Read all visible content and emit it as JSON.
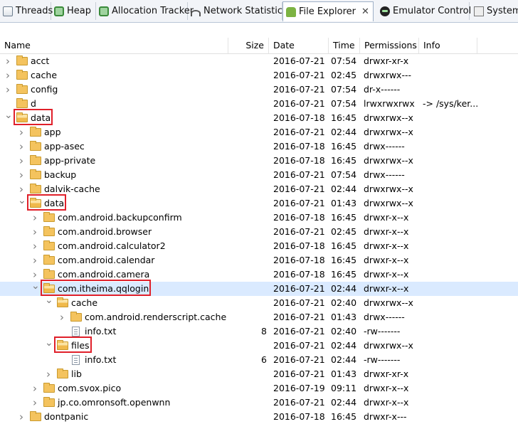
{
  "tabs": [
    {
      "label": "Threads",
      "icon": "threads-icon"
    },
    {
      "label": "Heap",
      "icon": "heap-icon"
    },
    {
      "label": "Allocation Tracker",
      "icon": "allocation-tracker-icon"
    },
    {
      "label": "Network Statistics",
      "icon": "network-icon"
    },
    {
      "label": "File Explorer",
      "icon": "android-icon",
      "active": true,
      "close": "✕"
    },
    {
      "label": "Emulator Control",
      "icon": "emulator-icon"
    },
    {
      "label": "System",
      "icon": "system-icon"
    }
  ],
  "columns": {
    "name": "Name",
    "size": "Size",
    "date": "Date",
    "time": "Time",
    "permissions": "Permissions",
    "info": "Info"
  },
  "rows": [
    {
      "name": "acct",
      "level": 0,
      "type": "folder",
      "state": "collapsed",
      "size": "",
      "date": "2016-07-21",
      "time": "07:54",
      "perm": "drwxr-xr-x",
      "info": ""
    },
    {
      "name": "cache",
      "level": 0,
      "type": "folder",
      "state": "collapsed",
      "size": "",
      "date": "2016-07-21",
      "time": "02:45",
      "perm": "drwxrwx---",
      "info": ""
    },
    {
      "name": "config",
      "level": 0,
      "type": "folder",
      "state": "collapsed",
      "size": "",
      "date": "2016-07-21",
      "time": "07:54",
      "perm": "dr-x------",
      "info": ""
    },
    {
      "name": "d",
      "level": 0,
      "type": "folder",
      "state": "none",
      "size": "",
      "date": "2016-07-21",
      "time": "07:54",
      "perm": "lrwxrwxrwx",
      "info": "-> /sys/ker..."
    },
    {
      "name": "data",
      "level": 0,
      "type": "folder",
      "state": "expanded",
      "size": "",
      "date": "2016-07-18",
      "time": "16:45",
      "perm": "drwxrwx--x",
      "info": "",
      "highlight": true
    },
    {
      "name": "app",
      "level": 1,
      "type": "folder",
      "state": "collapsed",
      "size": "",
      "date": "2016-07-21",
      "time": "02:44",
      "perm": "drwxrwx--x",
      "info": ""
    },
    {
      "name": "app-asec",
      "level": 1,
      "type": "folder",
      "state": "collapsed",
      "size": "",
      "date": "2016-07-18",
      "time": "16:45",
      "perm": "drwx------",
      "info": ""
    },
    {
      "name": "app-private",
      "level": 1,
      "type": "folder",
      "state": "collapsed",
      "size": "",
      "date": "2016-07-18",
      "time": "16:45",
      "perm": "drwxrwx--x",
      "info": ""
    },
    {
      "name": "backup",
      "level": 1,
      "type": "folder",
      "state": "collapsed",
      "size": "",
      "date": "2016-07-21",
      "time": "07:54",
      "perm": "drwx------",
      "info": ""
    },
    {
      "name": "dalvik-cache",
      "level": 1,
      "type": "folder",
      "state": "collapsed",
      "size": "",
      "date": "2016-07-21",
      "time": "02:44",
      "perm": "drwxrwx--x",
      "info": ""
    },
    {
      "name": "data",
      "level": 1,
      "type": "folder",
      "state": "expanded",
      "size": "",
      "date": "2016-07-21",
      "time": "01:43",
      "perm": "drwxrwx--x",
      "info": "",
      "highlight": true
    },
    {
      "name": "com.android.backupconfirm",
      "level": 2,
      "type": "folder",
      "state": "collapsed",
      "size": "",
      "date": "2016-07-18",
      "time": "16:45",
      "perm": "drwxr-x--x",
      "info": ""
    },
    {
      "name": "com.android.browser",
      "level": 2,
      "type": "folder",
      "state": "collapsed",
      "size": "",
      "date": "2016-07-21",
      "time": "02:45",
      "perm": "drwxr-x--x",
      "info": ""
    },
    {
      "name": "com.android.calculator2",
      "level": 2,
      "type": "folder",
      "state": "collapsed",
      "size": "",
      "date": "2016-07-18",
      "time": "16:45",
      "perm": "drwxr-x--x",
      "info": ""
    },
    {
      "name": "com.android.calendar",
      "level": 2,
      "type": "folder",
      "state": "collapsed",
      "size": "",
      "date": "2016-07-18",
      "time": "16:45",
      "perm": "drwxr-x--x",
      "info": ""
    },
    {
      "name": "com.android.camera",
      "level": 2,
      "type": "folder",
      "state": "collapsed",
      "size": "",
      "date": "2016-07-18",
      "time": "16:45",
      "perm": "drwxr-x--x",
      "info": ""
    },
    {
      "name": "com.itheima.qqlogin",
      "level": 2,
      "type": "folder",
      "state": "expanded",
      "size": "",
      "date": "2016-07-21",
      "time": "02:44",
      "perm": "drwxr-x--x",
      "info": "",
      "highlight": true,
      "selected": true
    },
    {
      "name": "cache",
      "level": 3,
      "type": "folder",
      "state": "expanded",
      "size": "",
      "date": "2016-07-21",
      "time": "02:40",
      "perm": "drwxrwx--x",
      "info": ""
    },
    {
      "name": "com.android.renderscript.cache",
      "level": 4,
      "type": "folder",
      "state": "collapsed",
      "size": "",
      "date": "2016-07-21",
      "time": "01:43",
      "perm": "drwx------",
      "info": ""
    },
    {
      "name": "info.txt",
      "level": 4,
      "type": "file",
      "state": "none",
      "size": "8",
      "date": "2016-07-21",
      "time": "02:40",
      "perm": "-rw-------",
      "info": ""
    },
    {
      "name": "files",
      "level": 3,
      "type": "folder",
      "state": "expanded",
      "size": "",
      "date": "2016-07-21",
      "time": "02:44",
      "perm": "drwxrwx--x",
      "info": "",
      "highlight": true
    },
    {
      "name": "info.txt",
      "level": 4,
      "type": "file",
      "state": "none",
      "size": "6",
      "date": "2016-07-21",
      "time": "02:44",
      "perm": "-rw-------",
      "info": ""
    },
    {
      "name": "lib",
      "level": 3,
      "type": "folder",
      "state": "collapsed",
      "size": "",
      "date": "2016-07-21",
      "time": "01:43",
      "perm": "drwxr-xr-x",
      "info": ""
    },
    {
      "name": "com.svox.pico",
      "level": 2,
      "type": "folder",
      "state": "collapsed",
      "size": "",
      "date": "2016-07-19",
      "time": "09:11",
      "perm": "drwxr-x--x",
      "info": ""
    },
    {
      "name": "jp.co.omronsoft.openwnn",
      "level": 2,
      "type": "folder",
      "state": "collapsed",
      "size": "",
      "date": "2016-07-21",
      "time": "02:44",
      "perm": "drwxr-x--x",
      "info": ""
    },
    {
      "name": "dontpanic",
      "level": 1,
      "type": "folder",
      "state": "collapsed",
      "size": "",
      "date": "2016-07-18",
      "time": "16:45",
      "perm": "drwxr-x---",
      "info": ""
    }
  ],
  "colors": {
    "selection": "#daeaff",
    "highlight_box": "#e0202a",
    "folder": "#f4c35e"
  }
}
